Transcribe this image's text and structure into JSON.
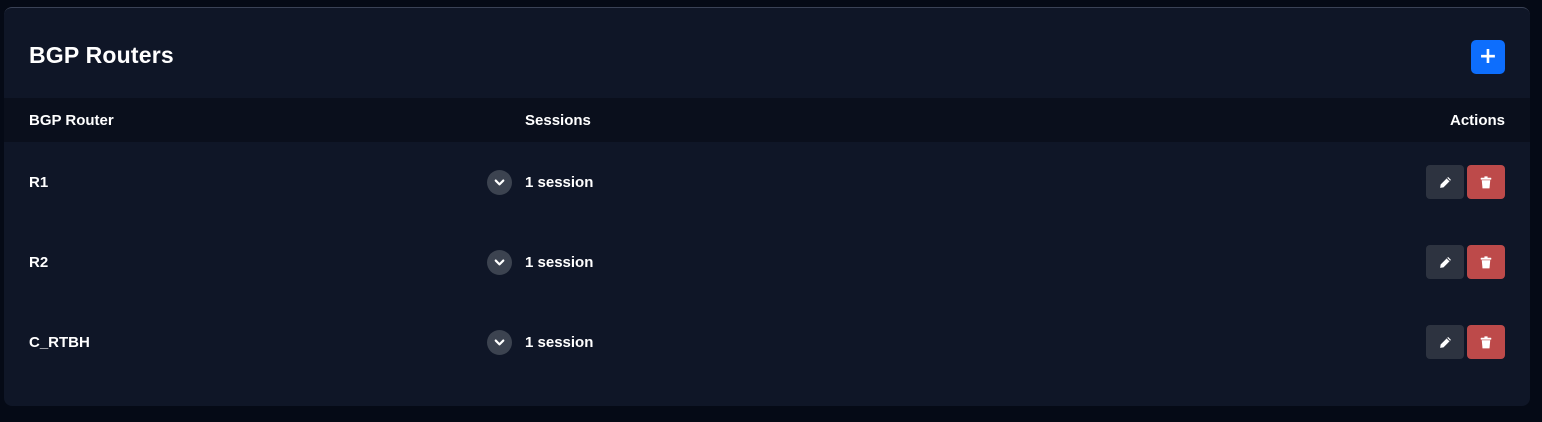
{
  "card": {
    "title": "BGP Routers",
    "add_label": "+"
  },
  "table": {
    "headers": {
      "router": "BGP Router",
      "sessions": "Sessions",
      "actions": "Actions"
    },
    "rows": [
      {
        "router": "R1",
        "sessions": "1 session"
      },
      {
        "router": "R2",
        "sessions": "1 session"
      },
      {
        "router": "C_RTBH",
        "sessions": "1 session"
      }
    ]
  },
  "icons": {
    "add": "plus-icon",
    "expand": "chevron-down-icon",
    "edit": "pencil-icon",
    "delete": "trash-icon"
  },
  "colors": {
    "background": "#050a16",
    "card": "#0f1627",
    "table_header": "#0a0f1c",
    "accent_primary": "#0d6efd",
    "edit_button": "#2d3340",
    "delete_button": "#bd4a4a",
    "toggle": "#3c4350"
  }
}
